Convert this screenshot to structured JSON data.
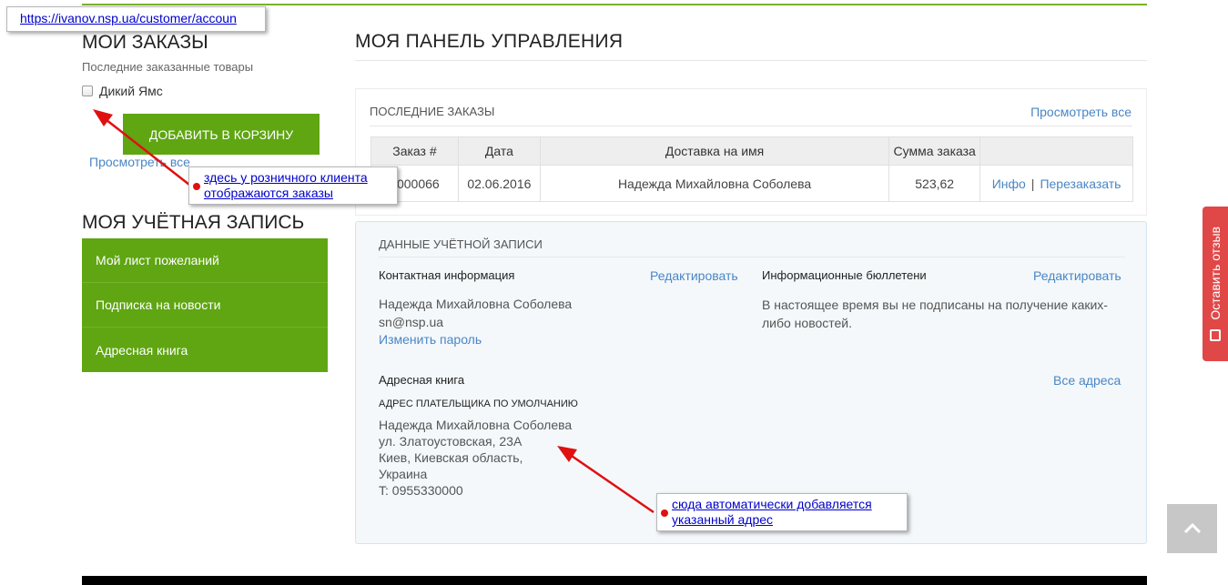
{
  "tooltip": {
    "url": "https://ivanov.nsp.ua/customer/accoun"
  },
  "sidebar": {
    "orders_title": "МОИ ЗАКАЗЫ",
    "orders_subtitle": "Последние заказанные товары",
    "product": "Дикий Ямс",
    "add_to_cart": "ДОБАВИТЬ В КОРЗИНУ",
    "view_all": "Просмотреть все",
    "account_title": "МОЯ УЧЁТНАЯ ЗАПИСЬ",
    "menu": [
      {
        "label": "Мой лист пожеланий"
      },
      {
        "label": "Подписка на новости"
      },
      {
        "label": "Адресная книга"
      }
    ]
  },
  "main": {
    "title": "МОЯ ПАНЕЛЬ УПРАВЛЕНИЯ",
    "recent_orders": {
      "heading": "ПОСЛЕДНИЕ ЗАКАЗЫ",
      "view_all": "Просмотреть все",
      "columns": [
        "Заказ #",
        "Дата",
        "Доставка на имя",
        "Сумма заказа",
        ""
      ],
      "rows": [
        {
          "order": "0000066",
          "date": "02.06.2016",
          "ship_to": "Надежда Михайловна Соболева",
          "total": "523,62",
          "info": "Инфо",
          "sep": "|",
          "reorder": "Перезаказать"
        }
      ]
    },
    "account": {
      "heading": "ДАННЫЕ УЧЁТНОЙ ЗАПИСИ",
      "contact": {
        "label": "Контактная информация",
        "edit": "Редактировать",
        "name": "Надежда Михайловна Соболева",
        "email": "sn@nsp.ua",
        "change_password": "Изменить пароль"
      },
      "newsletter": {
        "label": "Информационные бюллетени",
        "edit": "Редактировать",
        "text": "В настоящее время вы не подписаны на получение каких-либо новостей."
      },
      "address_book": {
        "label": "Адресная книга",
        "all": "Все адреса",
        "billing_label": "АДРЕС ПЛАТЕЛЬЩИКА ПО УМОЛЧАНИЮ",
        "lines": [
          "Надежда Михайловна Соболева",
          "ул. Златоустовская, 23А",
          "Киев, Киевская область,",
          "Украина",
          "T: 0955330000"
        ]
      }
    }
  },
  "annotations": {
    "note1": [
      "здесь у розничного клиента",
      "отображаются заказы"
    ],
    "note2": [
      "сюда автоматически добавляется",
      "указанный адрес"
    ]
  },
  "feedback": {
    "label": "Оставить отзыв"
  },
  "colors": {
    "green": "#5fa612",
    "link": "#4a86c4",
    "feedback": "#e04848",
    "arrow": "#e01010"
  }
}
